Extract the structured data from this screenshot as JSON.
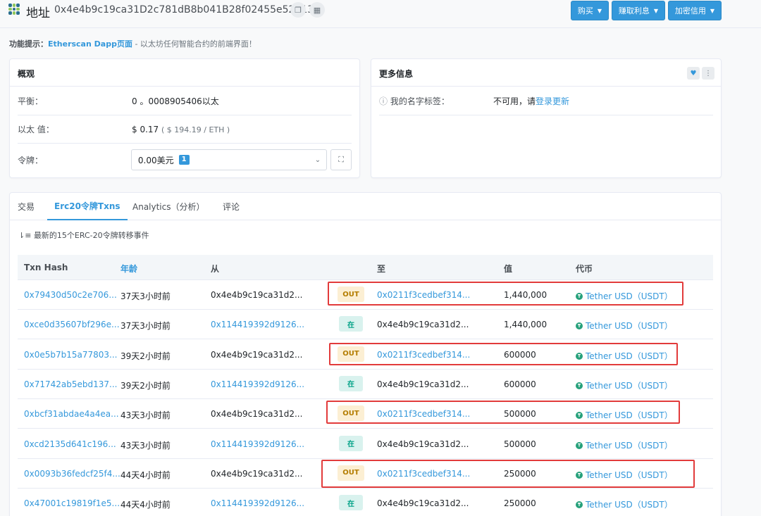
{
  "header": {
    "title": "地址",
    "address": "0x4e4b9c19ca31D2c781dB8b041B28f02455e52113",
    "copy_icon": "copy-icon",
    "qr_icon": "qr-code-icon",
    "buttons": [
      {
        "label": "购买"
      },
      {
        "label": "赚取利息"
      },
      {
        "label": "加密信用"
      }
    ]
  },
  "hint": {
    "label": "功能提示：",
    "link": "Etherscan Dapp页面",
    "text": " - 以太坊任何智能合约的前端界面！"
  },
  "overview": {
    "title": "概观",
    "balance_label": "平衡：",
    "balance_value": "0 。0008905406以太",
    "ether_value_label": "以太 值：",
    "ether_value": "$ 0.17",
    "ether_price": "( $ 194.19 / ETH )",
    "token_label": "令牌：",
    "token_value": "0.00美元",
    "token_count": "1"
  },
  "more_info": {
    "title": "更多信息",
    "name_tag_label": "我的名字标签：",
    "name_tag_prefix": "不可用，请",
    "name_tag_link": "登录更新"
  },
  "tabs": [
    {
      "label": "交易",
      "active": false
    },
    {
      "label": "Erc20令牌Txns",
      "active": true
    },
    {
      "label": "Analytics（分析）",
      "active": false
    },
    {
      "label": "评论",
      "active": false
    }
  ],
  "transfers": {
    "subtitle": "最新的15个ERC-20令牌转移事件",
    "columns": [
      "Txn Hash",
      "年龄",
      "从",
      "",
      "至",
      "值",
      "代币"
    ],
    "rows": [
      {
        "hash": "0x79430d50c2e706...",
        "age": "37天3小时前",
        "from": "0x4e4b9c19ca31d2...",
        "from_link": false,
        "dir": "OUT",
        "to": "0x0211f3cedbef314...",
        "to_link": true,
        "value": "1,440,000",
        "token": "Tether USD（USDT）"
      },
      {
        "hash": "0xce0d35607bf296e...",
        "age": "37天3小时前",
        "from": "0x114419392d9126...",
        "from_link": true,
        "dir": "在",
        "to": "0x4e4b9c19ca31d2...",
        "to_link": false,
        "value": "1,440,000",
        "token": "Tether USD（USDT）"
      },
      {
        "hash": "0x0e5b7b15a77803...",
        "age": "39天2小时前",
        "from": "0x4e4b9c19ca31d2...",
        "from_link": false,
        "dir": "OUT",
        "to": "0x0211f3cedbef314...",
        "to_link": true,
        "value": "600000",
        "token": "Tether USD（USDT）"
      },
      {
        "hash": "0x71742ab5ebd137...",
        "age": "39天2小时前",
        "from": "0x114419392d9126...",
        "from_link": true,
        "dir": "在",
        "to": "0x4e4b9c19ca31d2...",
        "to_link": false,
        "value": "600000",
        "token": "Tether USD（USDT）"
      },
      {
        "hash": "0xbcf31abdae4a4ea...",
        "age": "43天3小时前",
        "from": "0x4e4b9c19ca31d2...",
        "from_link": false,
        "dir": "OUT",
        "to": "0x0211f3cedbef314...",
        "to_link": true,
        "value": "500000",
        "token": "Tether USD（USDT）"
      },
      {
        "hash": "0xcd2135d641c196...",
        "age": "43天3小时前",
        "from": "0x114419392d9126...",
        "from_link": true,
        "dir": "在",
        "to": "0x4e4b9c19ca31d2...",
        "to_link": false,
        "value": "500000",
        "token": "Tether USD（USDT）"
      },
      {
        "hash": "0x0093b36fedcf25f4...",
        "age": "44天4小时前",
        "from": "0x4e4b9c19ca31d2...",
        "from_link": false,
        "dir": "OUT",
        "to": "0x0211f3cedbef314...",
        "to_link": true,
        "value": "250000",
        "token": "Tether USD（USDT）"
      },
      {
        "hash": "0x47001c19819f1e5...",
        "age": "44天4小时前",
        "from": "0x114419392d9126...",
        "from_link": true,
        "dir": "在",
        "to": "0x4e4b9c19ca31d2...",
        "to_link": false,
        "value": "250000",
        "token": "Tether USD（USDT）"
      }
    ]
  },
  "colors": {
    "accent": "#3498db",
    "out_badge": "#fcefd3",
    "in_badge": "#d9f2ee",
    "highlight": "#e23b3b",
    "tether": "#26a17b"
  }
}
